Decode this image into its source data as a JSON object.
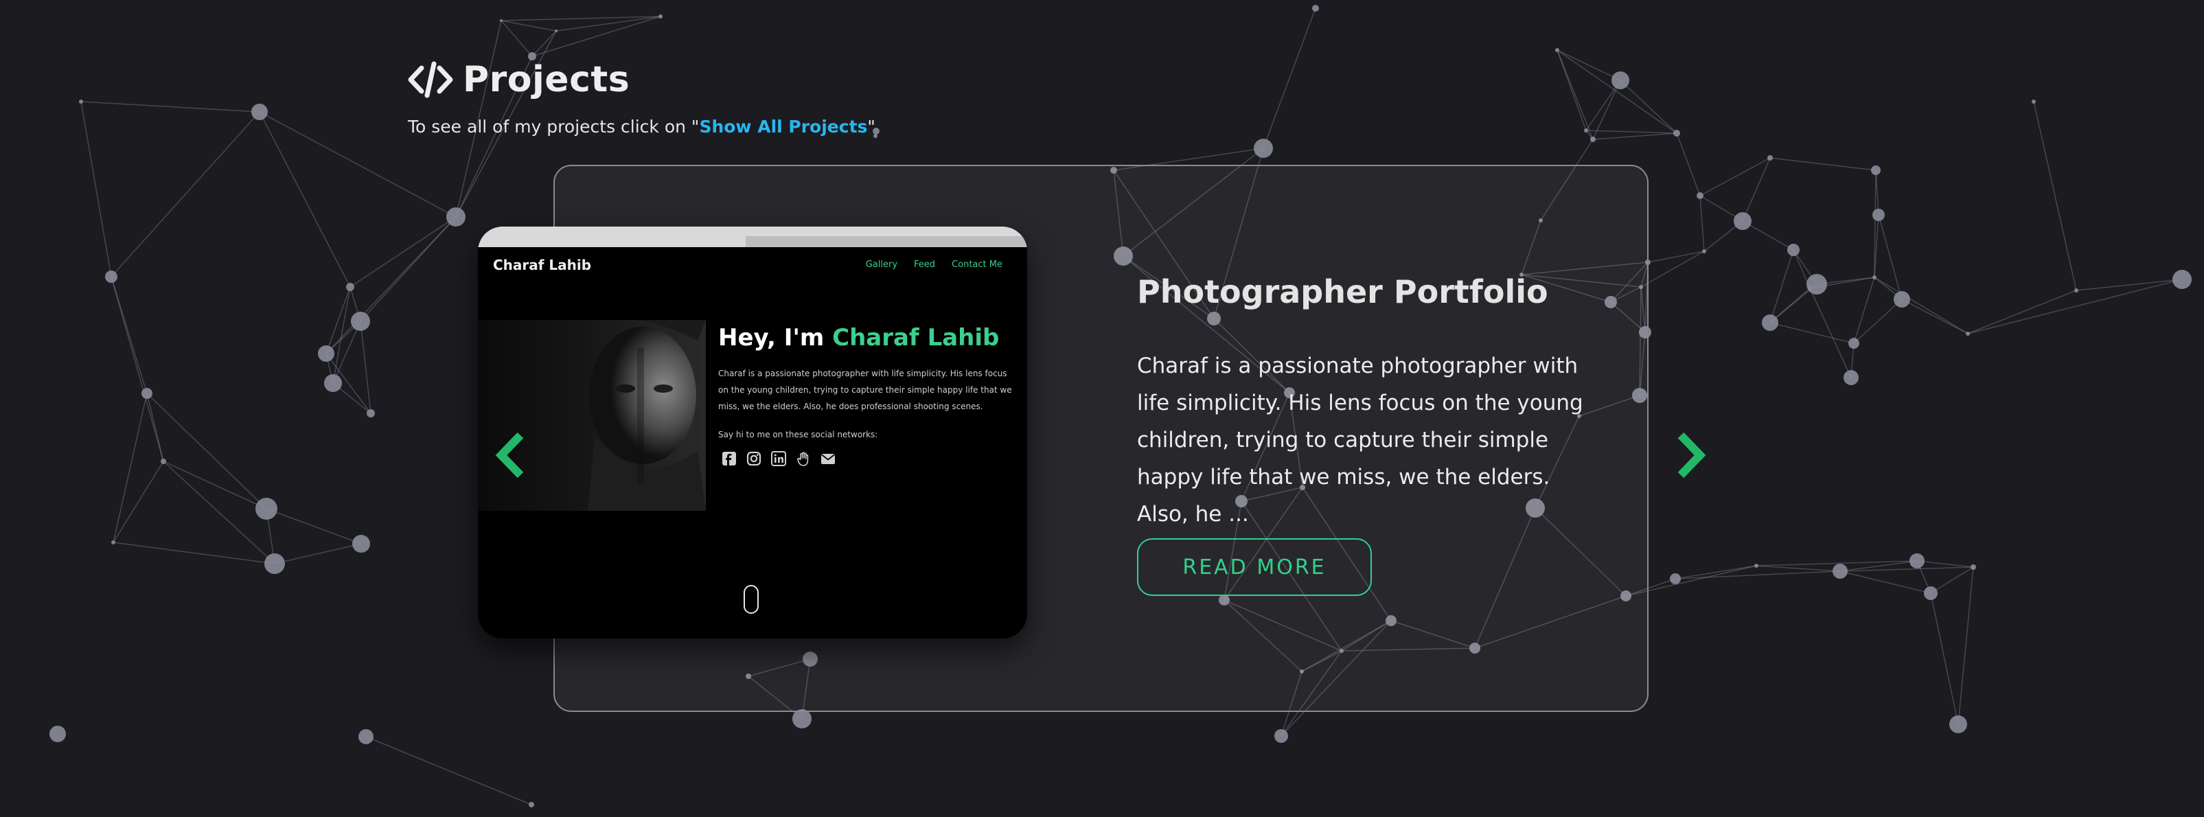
{
  "section": {
    "title": "Projects",
    "subtitle_prefix": "To see all of my projects click on \"",
    "subtitle_link": "Show All Projects",
    "subtitle_suffix": "\"",
    "icon": "code-icon"
  },
  "project": {
    "title": "Photographer Portfolio",
    "description": "Charaf is a passionate photographer with life simplicity. His lens focus on the young children, trying to capture their simple happy life that we miss, we the elders. Also, he ...",
    "read_more_label": "READ MORE"
  },
  "preview": {
    "brand": "Charaf Lahib",
    "nav": [
      "Gallery",
      "Feed",
      "Contact Me"
    ],
    "heading_prefix": "Hey, I'm ",
    "heading_name": "Charaf Lahib",
    "description": "Charaf is a passionate photographer with life simplicity. His lens focus on the young children, trying to capture their simple happy life that we miss, we the elders. Also, he does professional shooting scenes.",
    "social_label": "Say hi to me on these social networks:",
    "social_icons": [
      "facebook-icon",
      "instagram-icon",
      "linkedin-icon",
      "hand-icon",
      "envelope-icon"
    ]
  },
  "colors": {
    "background": "#1c1b20",
    "accent_green": "#2fd38a",
    "link_blue": "#27b6f0",
    "card_border": "#8b8b91"
  }
}
